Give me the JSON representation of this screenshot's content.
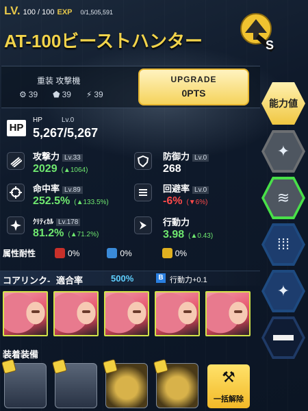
{
  "header": {
    "lv_label": "LV.",
    "lv_value": "100 / 100",
    "exp_label": "EXP",
    "exp_value": "0/1,505,591"
  },
  "unit": {
    "name": "AT-100ビーストハンター",
    "classes": "重装 攻撃機",
    "stats_small": [
      "39",
      "39",
      "39"
    ],
    "rank": "S"
  },
  "upgrade": {
    "label": "UPGRADE",
    "points": "0PTS"
  },
  "hp": {
    "label": "HP",
    "name": "HP",
    "lv": "Lv.0",
    "value": "5,267/5,267"
  },
  "stats": [
    {
      "name": "攻撃力",
      "lv": "Lv.33",
      "value": "2029",
      "up": "(▲1064)",
      "color": "green"
    },
    {
      "name": "防御力",
      "lv": "Lv.0",
      "value": "268",
      "up": "",
      "color": "white"
    },
    {
      "name": "命中率",
      "lv": "Lv.89",
      "value": "252.5%",
      "up": "(▲133.5%)",
      "color": "green"
    },
    {
      "name": "回避率",
      "lv": "Lv.0",
      "value": "-6%",
      "up": "(▼6%)",
      "color": "red"
    },
    {
      "name": "ｸﾘﾃｨｶﾙ",
      "lv": "Lv.178",
      "value": "81.2%",
      "up": "(▲71.2%)",
      "color": "green"
    },
    {
      "name": "行動力",
      "lv": "",
      "value": "3.98",
      "up": "(▲0.43)",
      "color": "green"
    }
  ],
  "resist": {
    "label": "属性耐性",
    "values": [
      "0%",
      "0%",
      "0%"
    ]
  },
  "core": {
    "label": "コアリンク-",
    "rate_label": "適合率",
    "rate": "500%",
    "badge": "B",
    "bonus": "行動力+0.1"
  },
  "equip": {
    "label": "装着装備",
    "release": "一括解除"
  },
  "side": {
    "stats_tab": "能力値"
  },
  "colors": {
    "gold": "#f1d34b",
    "green": "#6fe86f",
    "red": "#ff4a4a",
    "accent": "#5fd0ff"
  }
}
